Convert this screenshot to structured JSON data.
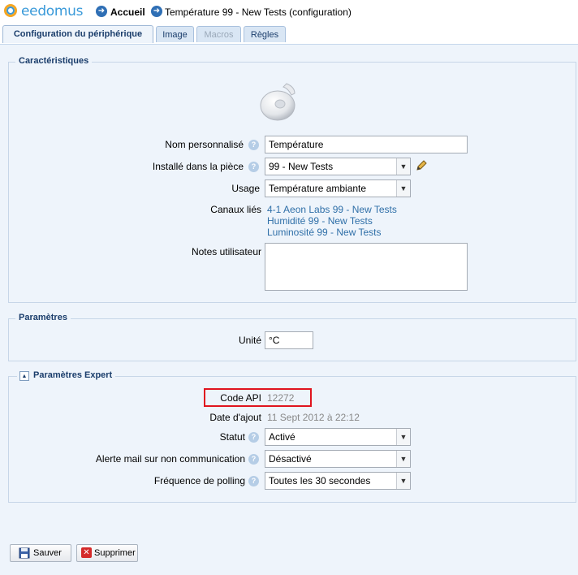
{
  "app": {
    "logo_text": "eedomus"
  },
  "breadcrumb": {
    "home_label": "Accueil",
    "page_label": "Température 99 - New Tests (configuration)"
  },
  "tabs": [
    {
      "label": "Configuration du périphérique",
      "state": "active"
    },
    {
      "label": "Image",
      "state": "normal"
    },
    {
      "label": "Macros",
      "state": "disabled"
    },
    {
      "label": "Règles",
      "state": "normal"
    }
  ],
  "caracteristiques": {
    "legend": "Caractéristiques",
    "nom_label": "Nom personnalisé",
    "nom_value": "Température",
    "piece_label": "Installé dans la pièce",
    "piece_value": "99 - New Tests",
    "usage_label": "Usage",
    "usage_value": "Température ambiante",
    "canaux_label": "Canaux liés",
    "canaux": [
      "4-1 Aeon Labs 99 - New Tests",
      "Humidité 99 - New Tests",
      "Luminosité 99 - New Tests"
    ],
    "notes_label": "Notes utilisateur",
    "notes_value": ""
  },
  "parametres": {
    "legend": "Paramètres",
    "unite_label": "Unité",
    "unite_value": "°C"
  },
  "expert": {
    "legend": "Paramètres Expert",
    "code_api_label": "Code API",
    "code_api_value": "12272",
    "date_label": "Date d'ajout",
    "date_value": "11 Sept 2012 à 22:12",
    "statut_label": "Statut",
    "statut_value": "Activé",
    "alerte_label": "Alerte mail sur non communication",
    "alerte_value": "Désactivé",
    "polling_label": "Fréquence de polling",
    "polling_value": "Toutes les 30 secondes"
  },
  "buttons": {
    "save_label": "Sauver",
    "delete_label": "Supprimer"
  },
  "colors": {
    "accent": "#2f6fa8",
    "highlight_box": "#e0141e",
    "panel_bg": "#eef4fb"
  }
}
